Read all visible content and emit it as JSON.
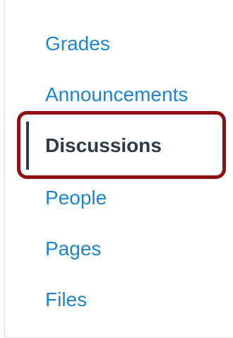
{
  "course_nav": {
    "items": [
      {
        "label": "Grades",
        "active": false
      },
      {
        "label": "Announcements",
        "active": false
      },
      {
        "label": "Discussions",
        "active": true
      },
      {
        "label": "People",
        "active": false
      },
      {
        "label": "Pages",
        "active": false
      },
      {
        "label": "Files",
        "active": false
      }
    ]
  },
  "colors": {
    "link": "#1f84cf",
    "active_text": "#2d3b45",
    "active_indicator": "#2d3b45",
    "highlight_outline": "#8f1010",
    "divider": "#d9dcde"
  }
}
